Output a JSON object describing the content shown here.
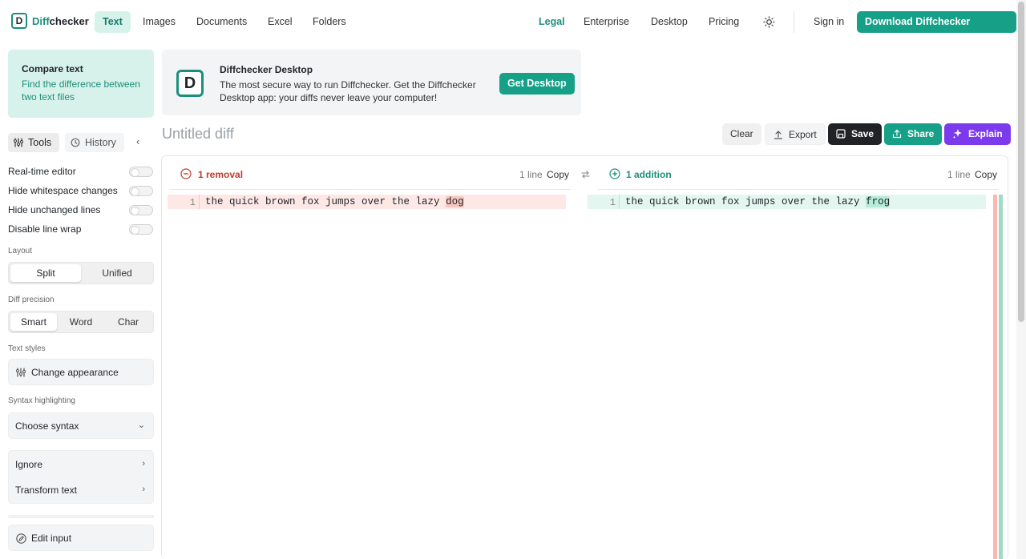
{
  "nav": {
    "logo_a": "Diff",
    "logo_b": "checker",
    "items": [
      "Text",
      "Images",
      "Documents",
      "Excel",
      "Folders"
    ],
    "right_items": [
      "Legal",
      "Enterprise",
      "Desktop",
      "Pricing"
    ],
    "sign_in": "Sign in",
    "download": "Download Diffchecker Desktop"
  },
  "promo_left": {
    "title": "Compare text",
    "subtitle": "Find the difference between two text files"
  },
  "promo_right": {
    "title": "Diffchecker Desktop",
    "body": "The most secure way to run Diffchecker. Get the Diffchecker Desktop app: your diffs never leave your computer!",
    "button": "Get Desktop"
  },
  "sidebar": {
    "tools": "Tools",
    "history": "History",
    "options": [
      "Real-time editor",
      "Hide whitespace changes",
      "Hide unchanged lines",
      "Disable line wrap"
    ],
    "layout_label": "Layout",
    "layout": [
      "Split",
      "Unified"
    ],
    "precision_label": "Diff precision",
    "precision": [
      "Smart",
      "Word",
      "Char"
    ],
    "text_styles_label": "Text styles",
    "change_appearance": "Change appearance",
    "syntax_label": "Syntax highlighting",
    "choose_syntax": "Choose syntax",
    "ignore": "Ignore",
    "transform": "Transform text",
    "edit_input": "Edit input"
  },
  "toolbar": {
    "title": "Untitled diff",
    "clear": "Clear",
    "export": "Export",
    "save": "Save",
    "share": "Share",
    "explain": "Explain"
  },
  "diff": {
    "left": {
      "summary": "1 removal",
      "lines": "1 line",
      "copy": "Copy",
      "num": "1",
      "prefix": "the quick brown fox jumps over the lazy ",
      "changed": "dog"
    },
    "right": {
      "summary": "1 addition",
      "lines": "1 line",
      "copy": "Copy",
      "num": "1",
      "prefix": "the quick brown fox jumps over the lazy ",
      "changed": "frog"
    }
  },
  "colors": {
    "accent": "#17a088",
    "remove": "#fde8e6",
    "add": "#e3f6ef",
    "explain": "#7c3aed"
  }
}
